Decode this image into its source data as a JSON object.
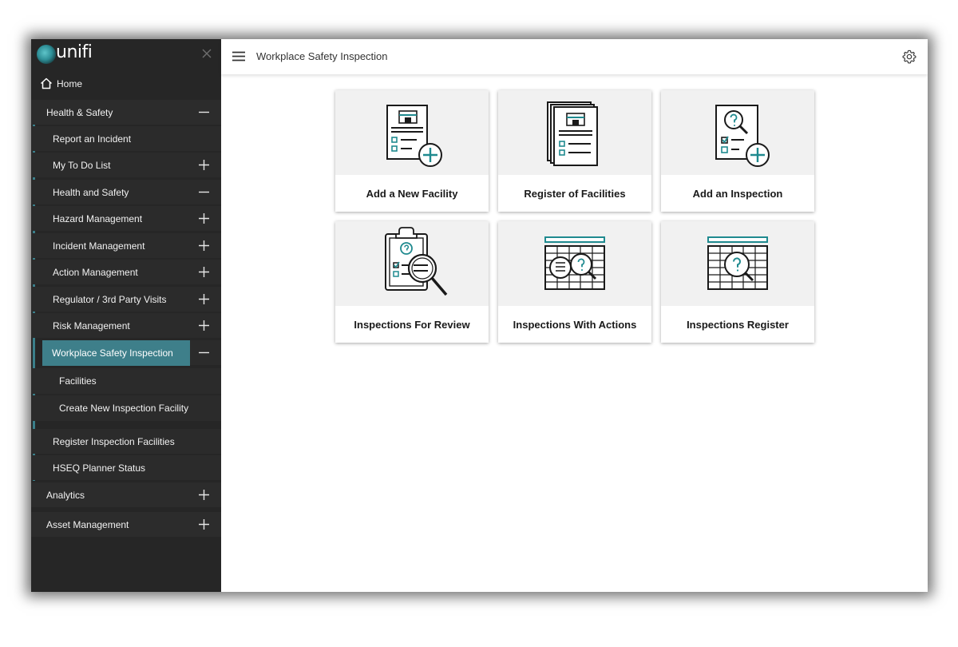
{
  "app": {
    "logo_text": "unifi",
    "accent_color": "#3e7f8a",
    "icon_teal": "#1f8a8f"
  },
  "header": {
    "title": "Workplace Safety Inspection",
    "menu_icon": "hamburger-icon",
    "settings_icon": "gear-icon"
  },
  "sidebar": {
    "home": "Home",
    "items": [
      {
        "label": "Health & Safety",
        "toggle": "minus"
      },
      {
        "label": "Report an Incident",
        "toggle": "none"
      },
      {
        "label": "My To Do List",
        "toggle": "plus"
      },
      {
        "label": "Health and Safety",
        "toggle": "minus"
      },
      {
        "label": "Hazard Management",
        "toggle": "plus"
      },
      {
        "label": "Incident Management",
        "toggle": "plus"
      },
      {
        "label": "Action Management",
        "toggle": "plus"
      },
      {
        "label": "Regulator / 3rd Party Visits",
        "toggle": "plus"
      },
      {
        "label": "Risk Management",
        "toggle": "plus"
      },
      {
        "label": "Workplace Safety Inspection",
        "toggle": "minus"
      },
      {
        "label": "Facilities",
        "toggle": "none"
      },
      {
        "label": "Create New Inspection Facility",
        "toggle": "none"
      },
      {
        "label": "Register Inspection Facilities",
        "toggle": "none"
      },
      {
        "label": "HSEQ Planner Status",
        "toggle": "none"
      },
      {
        "label": "Analytics",
        "toggle": "plus"
      },
      {
        "label": "Asset Management",
        "toggle": "plus"
      }
    ]
  },
  "tiles": [
    {
      "label": "Add a New Facility",
      "icon": "add-facility-icon"
    },
    {
      "label": "Register of Facilities",
      "icon": "facility-register-icon"
    },
    {
      "label": "Add an Inspection",
      "icon": "add-inspection-icon"
    },
    {
      "label": "Inspections For Review",
      "icon": "clipboard-review-icon"
    },
    {
      "label": "Inspections With Actions",
      "icon": "inspection-actions-icon"
    },
    {
      "label": "Inspections Register",
      "icon": "inspections-register-icon"
    }
  ]
}
